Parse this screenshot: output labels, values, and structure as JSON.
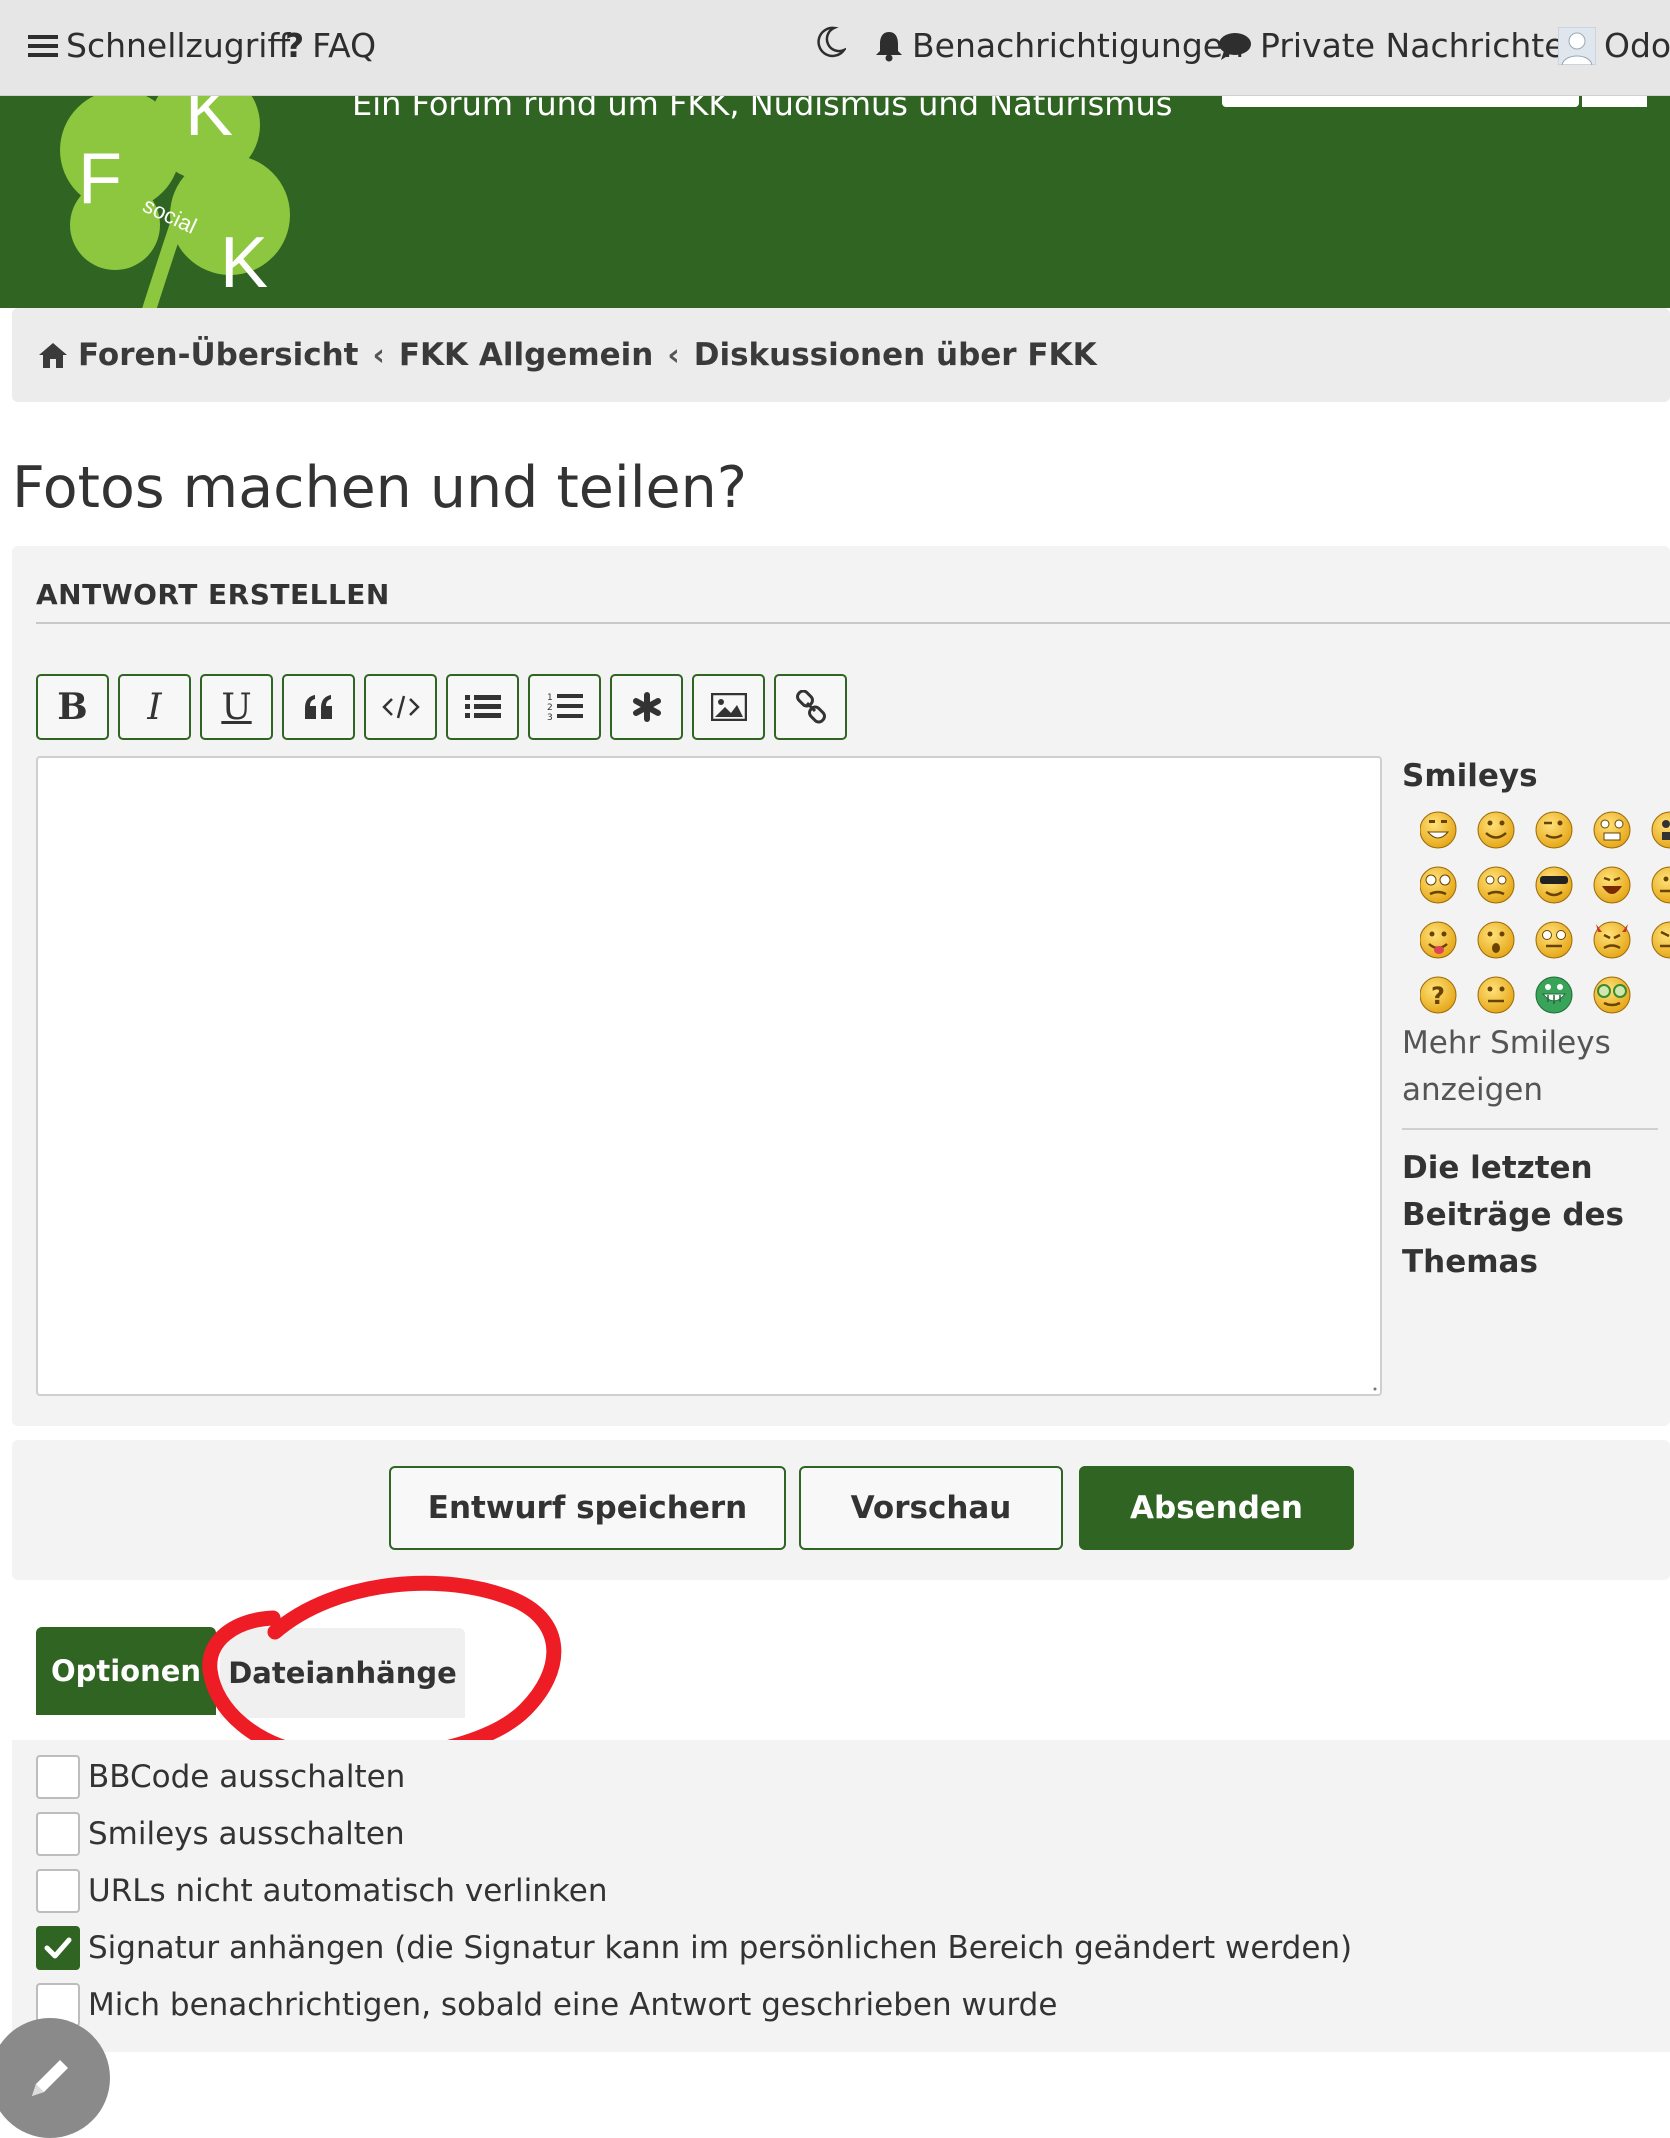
{
  "navbar": {
    "quick_access": "Schnellzugriff",
    "faq": "FAQ",
    "notifications": "Benachrichtigungen",
    "private_messages": "Private Nachrichten",
    "username": "OdoO"
  },
  "header": {
    "tagline": "Ein Forum rund um FKK, Nudismus und Naturismus",
    "logo_letters": [
      "F",
      "K",
      "K"
    ],
    "logo_sub": "social"
  },
  "breadcrumb": [
    "Foren-Übersicht",
    "FKK Allgemein",
    "Diskussionen über FKK"
  ],
  "page_title": "Fotos machen und teilen?",
  "reply": {
    "heading": "ANTWORT ERSTELLEN",
    "toolbar": [
      "bold",
      "italic",
      "underline",
      "quote",
      "code",
      "list",
      "list-numbered",
      "list-item",
      "image",
      "link"
    ],
    "smileys_title": "Smileys",
    "more_smileys": "Mehr Smileys anzeigen",
    "recent_posts": "Die letzten Beiträge des Themas"
  },
  "buttons": {
    "save_draft": "Entwurf speichern",
    "preview": "Vorschau",
    "submit": "Absenden"
  },
  "tabs": {
    "options": "Optionen",
    "attachments": "Dateianhänge"
  },
  "options": [
    {
      "label": "BBCode ausschalten",
      "checked": false
    },
    {
      "label": "Smileys ausschalten",
      "checked": false
    },
    {
      "label": "URLs nicht automatisch verlinken",
      "checked": false
    },
    {
      "label": "Signatur anhängen (die Signatur kann im persönlichen Bereich geändert werden)",
      "checked": true
    },
    {
      "label": "Mich benachrichtigen, sobald eine Antwort geschrieben wurde",
      "checked": false
    }
  ],
  "colors": {
    "brand_green": "#2f6422",
    "logo_green": "#8dc63f",
    "annotation_red": "#ee1c25"
  }
}
